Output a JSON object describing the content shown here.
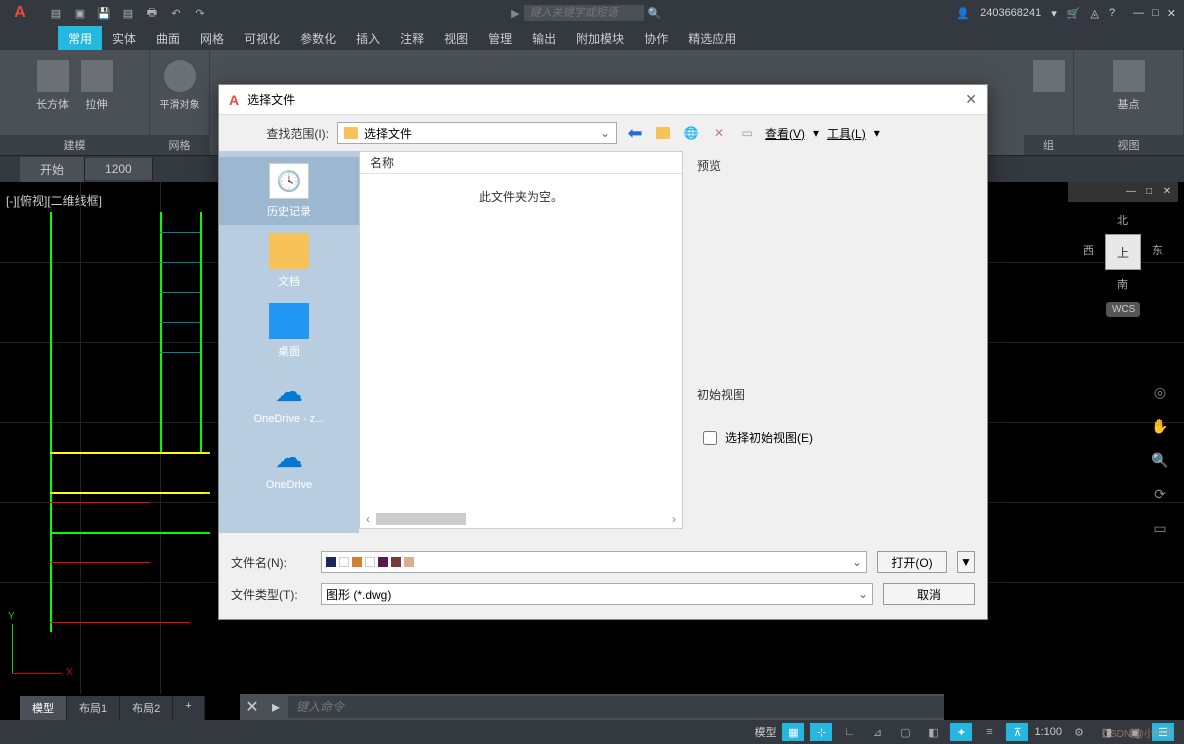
{
  "titlebar": {
    "search_placeholder": "键入关键字或短语",
    "username": "2403668241"
  },
  "ribbon": {
    "tabs": [
      "常用",
      "实体",
      "曲面",
      "网格",
      "可视化",
      "参数化",
      "插入",
      "注释",
      "视图",
      "管理",
      "输出",
      "附加模块",
      "协作",
      "精选应用"
    ],
    "group1": {
      "btn1": "长方体",
      "btn2": "拉伸",
      "title": "建模"
    },
    "group2": {
      "btn1": "平滑对象",
      "title": "网格"
    },
    "group_last_a": {
      "title": "组"
    },
    "group_last_b": {
      "title": "基点",
      "title2": "视图"
    }
  },
  "doc_tabs": {
    "start": "开始",
    "doc": "1200"
  },
  "view_label": "[-][俯视][二维线框]",
  "viewcube": {
    "face": "上",
    "n": "北",
    "s": "南",
    "e": "东",
    "w": "西",
    "wcs": "WCS"
  },
  "cmd": {
    "placeholder": "键入命令"
  },
  "layout_tabs": [
    "模型",
    "布局1",
    "布局2"
  ],
  "status": {
    "model": "模型",
    "scale": "1:100"
  },
  "dialog": {
    "title": "选择文件",
    "lookin_label": "查找范围(I):",
    "lookin_value": "选择文件",
    "view_btn": "查看(V)",
    "tools_btn": "工具(L)",
    "sidebar": {
      "history": "历史记录",
      "documents": "文档",
      "desktop": "桌面",
      "onedrive_z": "OneDrive - z...",
      "onedrive": "OneDrive"
    },
    "filelist": {
      "col_name": "名称",
      "empty": "此文件夹为空。"
    },
    "preview_label": "预览",
    "initview_label": "初始视图",
    "initview_check": "选择初始视图(E)",
    "filename_label": "文件名(N):",
    "filetype_label": "文件类型(T):",
    "filetype_value": "图形 (*.dwg)",
    "open_btn": "打开(O)",
    "cancel_btn": "取消"
  },
  "watermark": "CSDN @小哈里"
}
